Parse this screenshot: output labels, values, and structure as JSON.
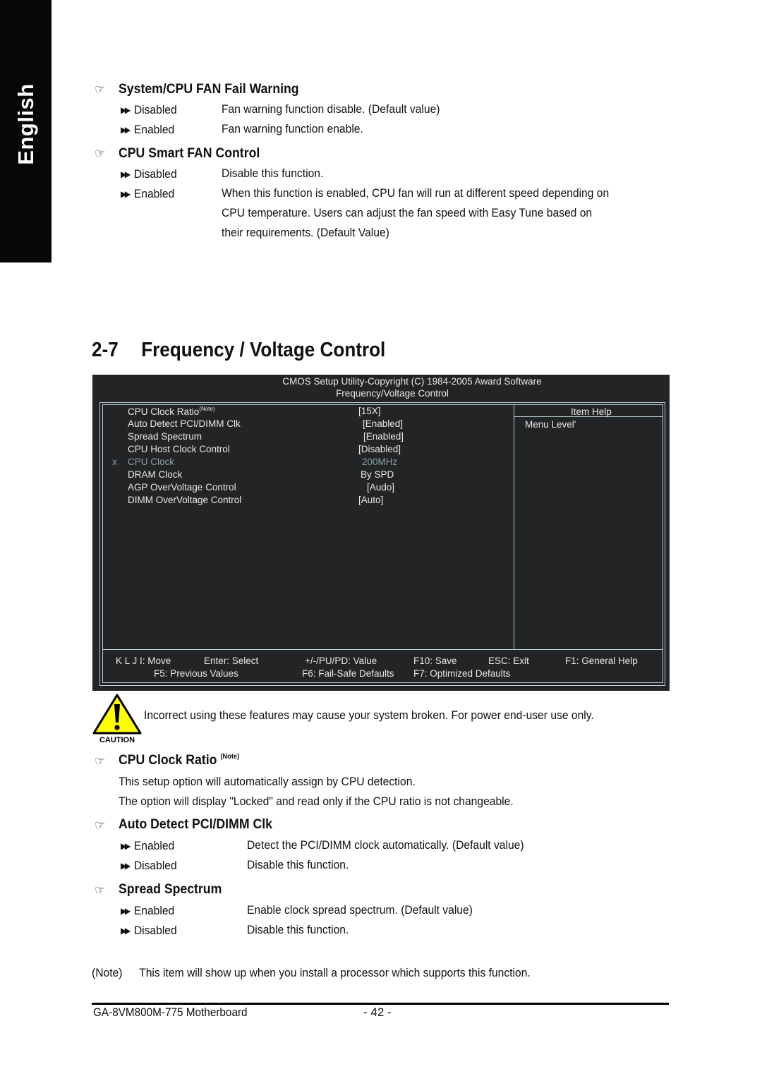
{
  "side_tab": {
    "label": "English"
  },
  "sections_top": [
    {
      "heading": "System/CPU FAN Fail Warning",
      "options": [
        {
          "name": "Disabled",
          "desc": [
            "Fan warning function disable. (Default value)"
          ]
        },
        {
          "name": "Enabled",
          "desc": [
            "Fan warning function enable."
          ]
        }
      ]
    },
    {
      "heading": "CPU Smart FAN Control",
      "options": [
        {
          "name": "Disabled",
          "desc": [
            "Disable this function."
          ]
        },
        {
          "name": "Enabled",
          "desc": [
            "When this function is enabled, CPU fan will run at different speed depending on",
            "CPU temperature. Users can adjust the fan speed with Easy Tune based on",
            "their requirements. (Default Value)"
          ]
        }
      ]
    }
  ],
  "chapter": {
    "number": "2-7",
    "title": "Frequency / Voltage Control"
  },
  "bios": {
    "header_line1": "CMOS Setup Utility-Copyright (C) 1984-2005 Award Software",
    "header_line2": "Frequency/Voltage Control",
    "items": [
      {
        "label": "CPU Clock Ratio",
        "sup": "(Note)",
        "value": "[15X]",
        "disabled": false
      },
      {
        "label": "Auto Detect PCI/DIMM Clk",
        "value": "[Enabled]",
        "disabled": false
      },
      {
        "label": "Spread Spectrum",
        "value": "[Enabled]",
        "disabled": false
      },
      {
        "label": "CPU Host Clock Control",
        "value": "[Disabled]",
        "disabled": false
      },
      {
        "label": "CPU Clock",
        "value": "200MHz",
        "disabled": true,
        "mark": "x"
      },
      {
        "label": "DRAM Clock",
        "value": "By SPD",
        "disabled": false
      },
      {
        "label": "AGP OverVoltage Control",
        "value": "[Audo]",
        "disabled": false
      },
      {
        "label": "DIMM OverVoltage Control",
        "value": "[Auto]",
        "disabled": false
      }
    ],
    "help_title": "Item Help",
    "help_menu_level": "Menu Level'",
    "footer_row1": [
      "K L J I: Move",
      "Enter: Select",
      "+/-/PU/PD: Value",
      "F10: Save",
      "ESC: Exit",
      "F1: General Help"
    ],
    "footer_row2": [
      "F5: Previous Values",
      "F6: Fail-Safe Defaults",
      "F7: Optimized Defaults"
    ],
    "colors": {
      "background": "#222426",
      "frame": "#b9cfd0",
      "text": "#e8e8e8",
      "disabled_text": "#8aa2a4"
    }
  },
  "caution": {
    "icon_label": "CAUTION",
    "text": "Incorrect using these features may cause your system broken. For power end-user use only."
  },
  "sections_bottom": [
    {
      "heading": "CPU Clock Ratio",
      "sup": "(Note)",
      "paragraphs": [
        "This setup option will automatically assign by CPU detection.",
        "The option will display \"Locked\" and read only if the CPU ratio is not changeable."
      ]
    },
    {
      "heading": "Auto Detect PCI/DIMM Clk",
      "options": [
        {
          "name": "Enabled",
          "desc": "Detect the PCI/DIMM clock automatically. (Default value)"
        },
        {
          "name": "Disabled",
          "desc": "Disable this function."
        }
      ]
    },
    {
      "heading": "Spread Spectrum",
      "options": [
        {
          "name": "Enabled",
          "desc": "Enable clock spread spectrum. (Default value)"
        },
        {
          "name": "Disabled",
          "desc": "Disable this function."
        }
      ]
    }
  ],
  "note": {
    "tag": "(Note)",
    "text": "This item will show up when you install a processor which supports this function."
  },
  "footer": {
    "product": "GA-8VM800M-775 Motherboard",
    "page": "- 42 -"
  },
  "icons": {
    "section_marker": "pointing-hand-icon",
    "option_marker": "double-arrow-icon",
    "caution": "warning-triangle-icon"
  }
}
